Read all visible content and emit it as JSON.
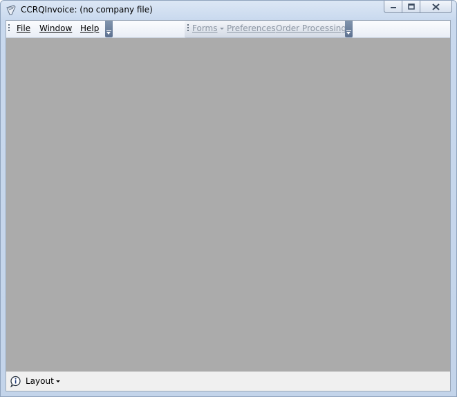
{
  "window": {
    "title": "CCRQInvoice: (no company file)"
  },
  "menu": {
    "items": [
      {
        "label": "File"
      },
      {
        "label": "Window"
      },
      {
        "label": "Help"
      }
    ]
  },
  "toolbar": {
    "items": [
      {
        "label": "Forms",
        "has_dropdown": true,
        "enabled": false
      },
      {
        "label": "Preferences",
        "enabled": false
      },
      {
        "label": "Order Processing",
        "enabled": false
      }
    ]
  },
  "status": {
    "layout_label": "Layout"
  },
  "icons": {
    "app": "app-logo-icon",
    "minimize": "minimize-icon",
    "maximize": "maximize-icon",
    "close": "close-icon",
    "layout": "info-icon"
  },
  "colors": {
    "mdi_background": "#ababab",
    "disabled_text": "#8c96a3",
    "overflow_button": "#6f82a0"
  }
}
